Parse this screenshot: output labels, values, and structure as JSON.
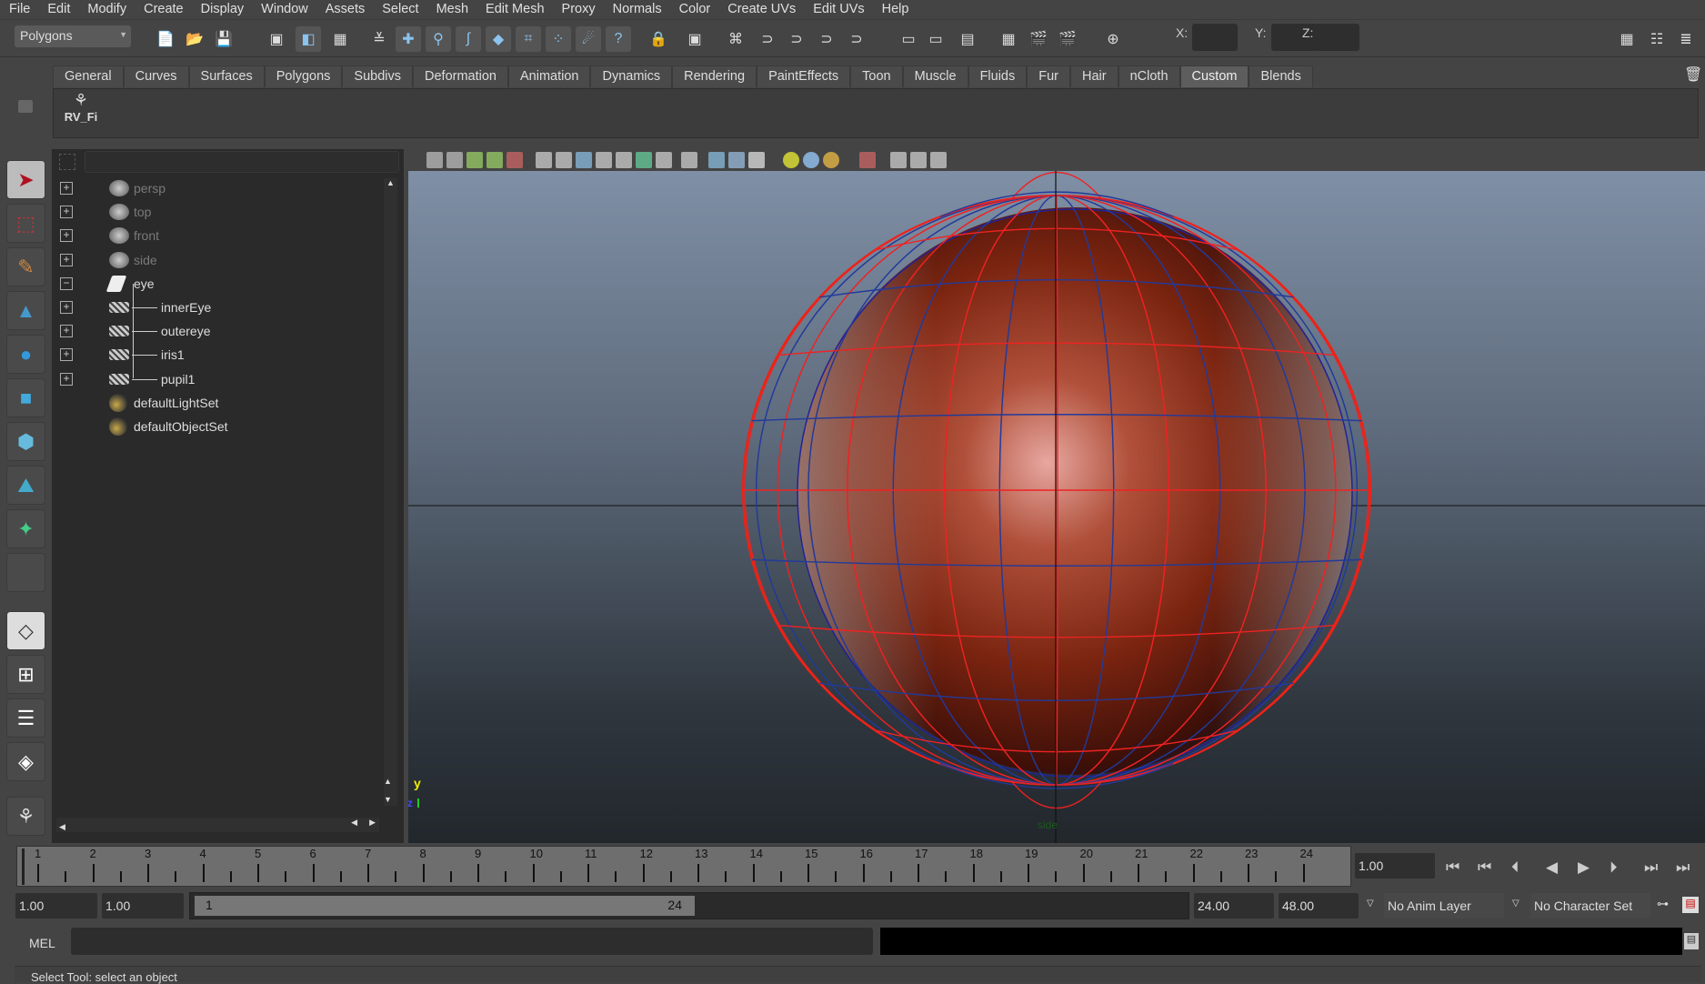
{
  "menu": [
    "File",
    "Edit",
    "Modify",
    "Create",
    "Display",
    "Window",
    "Assets",
    "Select",
    "Mesh",
    "Edit Mesh",
    "Proxy",
    "Normals",
    "Color",
    "Create UVs",
    "Edit UVs",
    "Help"
  ],
  "toolbar": {
    "mode": "Polygons",
    "x_label": "X:",
    "y_label": "Y:",
    "z_label": "Z:"
  },
  "shelf": {
    "tabs": [
      "General",
      "Curves",
      "Surfaces",
      "Polygons",
      "Subdivs",
      "Deformation",
      "Animation",
      "Dynamics",
      "Rendering",
      "PaintEffects",
      "Toon",
      "Muscle",
      "Fluids",
      "Fur",
      "Hair",
      "nCloth",
      "Custom",
      "Blends"
    ],
    "active": "Custom",
    "button_label": "RV_Fi"
  },
  "outliner": {
    "items": [
      {
        "label": "persp",
        "expand": "+",
        "icon": "camera",
        "dim": true,
        "indent": 0
      },
      {
        "label": "top",
        "expand": "+",
        "icon": "camera",
        "dim": true,
        "indent": 0
      },
      {
        "label": "front",
        "expand": "+",
        "icon": "camera",
        "dim": true,
        "indent": 0
      },
      {
        "label": "side",
        "expand": "+",
        "icon": "camera",
        "dim": true,
        "indent": 0
      },
      {
        "label": "eye",
        "expand": "−",
        "icon": "group",
        "dim": false,
        "indent": 0
      },
      {
        "label": "innerEye",
        "expand": "+",
        "icon": "mesh",
        "dim": false,
        "indent": 1
      },
      {
        "label": "outereye",
        "expand": "+",
        "icon": "mesh",
        "dim": false,
        "indent": 1
      },
      {
        "label": "iris1",
        "expand": "+",
        "icon": "mesh",
        "dim": false,
        "indent": 1
      },
      {
        "label": "pupil1",
        "expand": "+",
        "icon": "mesh",
        "dim": false,
        "indent": 1
      },
      {
        "label": "defaultLightSet",
        "expand": "",
        "icon": "set",
        "dim": false,
        "indent": 0
      },
      {
        "label": "defaultObjectSet",
        "expand": "",
        "icon": "set",
        "dim": false,
        "indent": 0
      }
    ]
  },
  "viewport": {
    "camera_label": "side",
    "axis_y": "y",
    "axis_z": "z"
  },
  "timeline": {
    "frames": [
      1,
      2,
      3,
      4,
      5,
      6,
      7,
      8,
      9,
      10,
      11,
      12,
      13,
      14,
      15,
      16,
      17,
      18,
      19,
      20,
      21,
      22,
      23,
      24
    ],
    "current_frame": "1.00"
  },
  "range": {
    "start": "1.00",
    "playback_start": "1.00",
    "slider_start": "1",
    "slider_end": "24",
    "playback_end": "24.00",
    "end": "48.00",
    "anim_layer": "No Anim Layer",
    "character_set": "No Character Set"
  },
  "mel": {
    "label": "MEL"
  },
  "status": {
    "text": "Select Tool: select an object"
  }
}
